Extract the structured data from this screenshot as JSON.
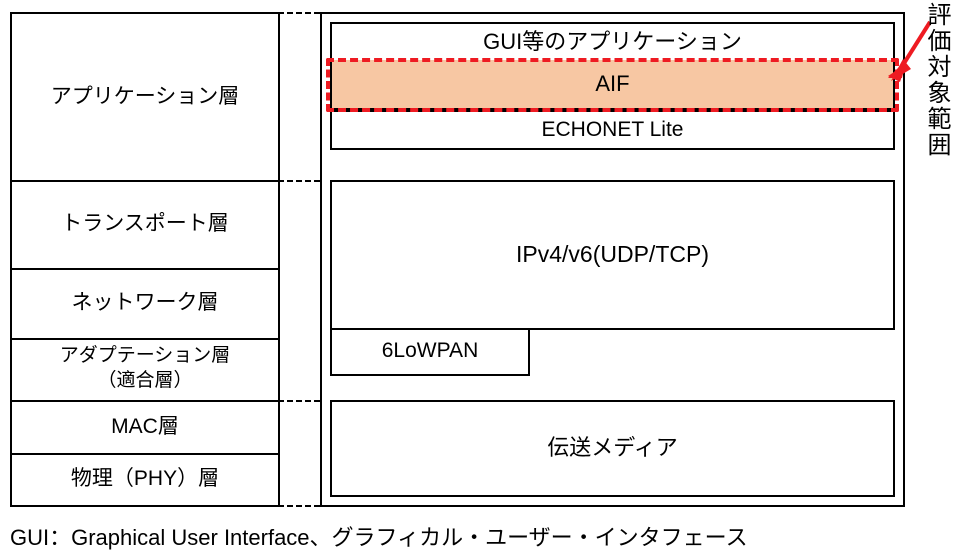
{
  "layers": {
    "application": "アプリケーション層",
    "transport": "トランスポート層",
    "network": "ネットワーク層",
    "adaptation": "アダプテーション層\n（適合層）",
    "mac": "MAC層",
    "physical": "物理（PHY）層"
  },
  "right": {
    "gui": "GUI等のアプリケーション",
    "aif": "AIF",
    "echonet": "ECHONET Lite",
    "ip": "IPv4/v6(UDP/TCP)",
    "sixlowpan": "6LoWPAN",
    "media": "伝送メディア"
  },
  "annotation": {
    "side_label": "評価対象範囲"
  },
  "footnote": "GUI：Graphical User Interface、グラフィカル・ユーザー・インタフェース"
}
